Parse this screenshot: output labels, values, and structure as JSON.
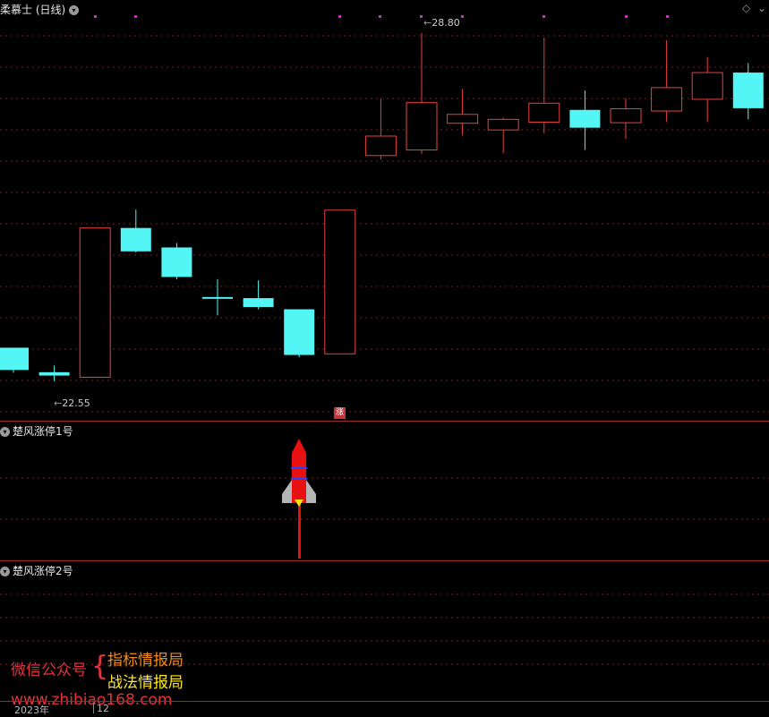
{
  "main_panel": {
    "title": "柔慕士 (日线)",
    "high_label": "28.80",
    "low_label": "22.55",
    "limit_up_marker": "涨"
  },
  "panel2": {
    "title": "楚风涨停1号"
  },
  "panel3": {
    "title": "楚风涨停2号"
  },
  "promo": {
    "account_label": "微信公众号",
    "brace": "{",
    "name1": "指标情报局",
    "name2": "战法情报局",
    "website": "www.zhibiao168.com"
  },
  "time_axis": {
    "year": "2023年",
    "month": "12"
  },
  "colors": {
    "up": "#e8423f",
    "down": "#54f5f5",
    "separator": "#a0262a",
    "grid": "#7a1c1c"
  },
  "chart_data": {
    "type": "candlestick",
    "ylim": [
      22.0,
      29.2
    ],
    "high_annotation": 28.8,
    "low_annotation": 22.55,
    "candles": [
      {
        "o": 23.15,
        "h": 23.15,
        "c": 22.75,
        "l": 22.7,
        "dir": "down"
      },
      {
        "o": 22.71,
        "h": 22.83,
        "c": 22.65,
        "l": 22.55,
        "dir": "down"
      },
      {
        "o": 22.62,
        "h": 25.3,
        "c": 25.3,
        "l": 22.62,
        "dir": "up"
      },
      {
        "o": 25.3,
        "h": 25.63,
        "c": 24.88,
        "l": 24.86,
        "dir": "down"
      },
      {
        "o": 24.95,
        "h": 25.03,
        "c": 24.42,
        "l": 24.38,
        "dir": "down"
      },
      {
        "o": 24.06,
        "h": 24.38,
        "c": 24.05,
        "l": 23.73,
        "dir": "down"
      },
      {
        "o": 24.04,
        "h": 24.36,
        "c": 23.88,
        "l": 23.84,
        "dir": "down"
      },
      {
        "o": 23.84,
        "h": 23.83,
        "c": 23.02,
        "l": 22.98,
        "dir": "down"
      },
      {
        "o": 23.04,
        "h": 25.62,
        "c": 25.62,
        "l": 23.04,
        "dir": "up"
      },
      {
        "o": 26.6,
        "h": 27.62,
        "c": 26.95,
        "l": 26.53,
        "dir": "up"
      },
      {
        "o": 26.7,
        "h": 28.8,
        "c": 27.55,
        "l": 26.63,
        "dir": "up"
      },
      {
        "o": 27.18,
        "h": 27.8,
        "c": 27.34,
        "l": 26.96,
        "dir": "up"
      },
      {
        "o": 27.06,
        "h": 27.28,
        "c": 27.25,
        "l": 26.64,
        "dir": "up"
      },
      {
        "o": 27.2,
        "h": 28.72,
        "c": 27.54,
        "l": 27.0,
        "dir": "up"
      },
      {
        "o": 27.42,
        "h": 27.77,
        "c": 27.1,
        "l": 26.7,
        "dir": "down"
      },
      {
        "o": 27.19,
        "h": 27.63,
        "c": 27.44,
        "l": 26.9,
        "dir": "up"
      },
      {
        "o": 27.4,
        "h": 28.67,
        "c": 27.82,
        "l": 27.2,
        "dir": "up"
      },
      {
        "o": 27.61,
        "h": 28.37,
        "c": 28.09,
        "l": 27.2,
        "dir": "up"
      },
      {
        "o": 28.09,
        "h": 28.26,
        "c": 27.45,
        "l": 27.25,
        "dir": "down"
      }
    ]
  }
}
